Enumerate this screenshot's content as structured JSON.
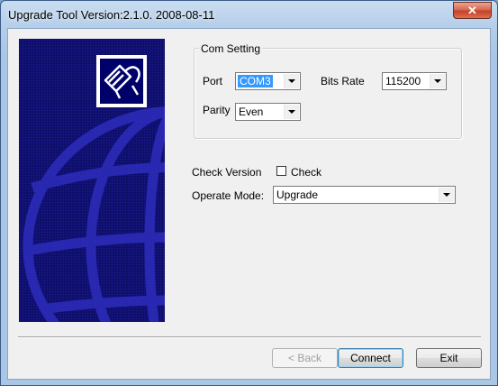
{
  "window": {
    "title": "Upgrade Tool Version:2.1.0. 2008-08-11",
    "close_symbol": "✕"
  },
  "com_setting": {
    "legend": "Com Setting",
    "port_label": "Port",
    "port_value": "COM3",
    "bits_rate_label": "Bits Rate",
    "bits_rate_value": "115200",
    "parity_label": "Parity",
    "parity_value": "Even"
  },
  "check_version": {
    "label": "Check Version",
    "checkbox_label": "Check",
    "checked": false
  },
  "operate_mode": {
    "label": "Operate Mode:",
    "value": "Upgrade"
  },
  "buttons": {
    "back": "< Back",
    "connect": "Connect",
    "exit": "Exit"
  },
  "icons": {
    "banner_logo": "network-cable-icon",
    "close": "close-icon",
    "dropdown": "chevron-down-icon"
  },
  "colors": {
    "banner_bg": "#0c0c5e",
    "globe_lines": "#2b2bb8",
    "selection": "#3399ff",
    "close_button": "#c7402a"
  }
}
